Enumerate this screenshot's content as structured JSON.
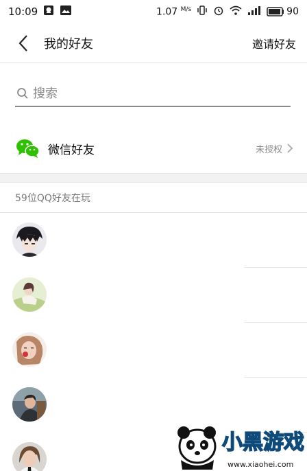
{
  "status_bar": {
    "time": "10:09",
    "speed_value": "1.07",
    "speed_unit": "M/s",
    "battery": "90",
    "icons": [
      "qq-notification-icon",
      "image-notification-icon",
      "vibrate-icon",
      "alarm-icon",
      "wifi-icon",
      "signal-icon",
      "battery-icon"
    ]
  },
  "header": {
    "title": "我的好友",
    "invite_label": "邀请好友",
    "back_icon": "back-arrow-icon"
  },
  "search": {
    "placeholder": "搜索",
    "value": ""
  },
  "wechat": {
    "label": "微信好友",
    "status": "未授权",
    "icon": "wechat-icon",
    "brand_color": "#2dc100"
  },
  "qq_section": {
    "title": "59位QQ好友在玩"
  },
  "friends": [
    {
      "avatar": "avatar-anime"
    },
    {
      "avatar": "avatar-girl-green"
    },
    {
      "avatar": "avatar-girl-red"
    },
    {
      "avatar": "avatar-boy-tree"
    },
    {
      "avatar": "avatar-woman-tie"
    }
  ],
  "watermark": {
    "text_big": "小黑游戏",
    "url": "www.xiaohei.com"
  }
}
